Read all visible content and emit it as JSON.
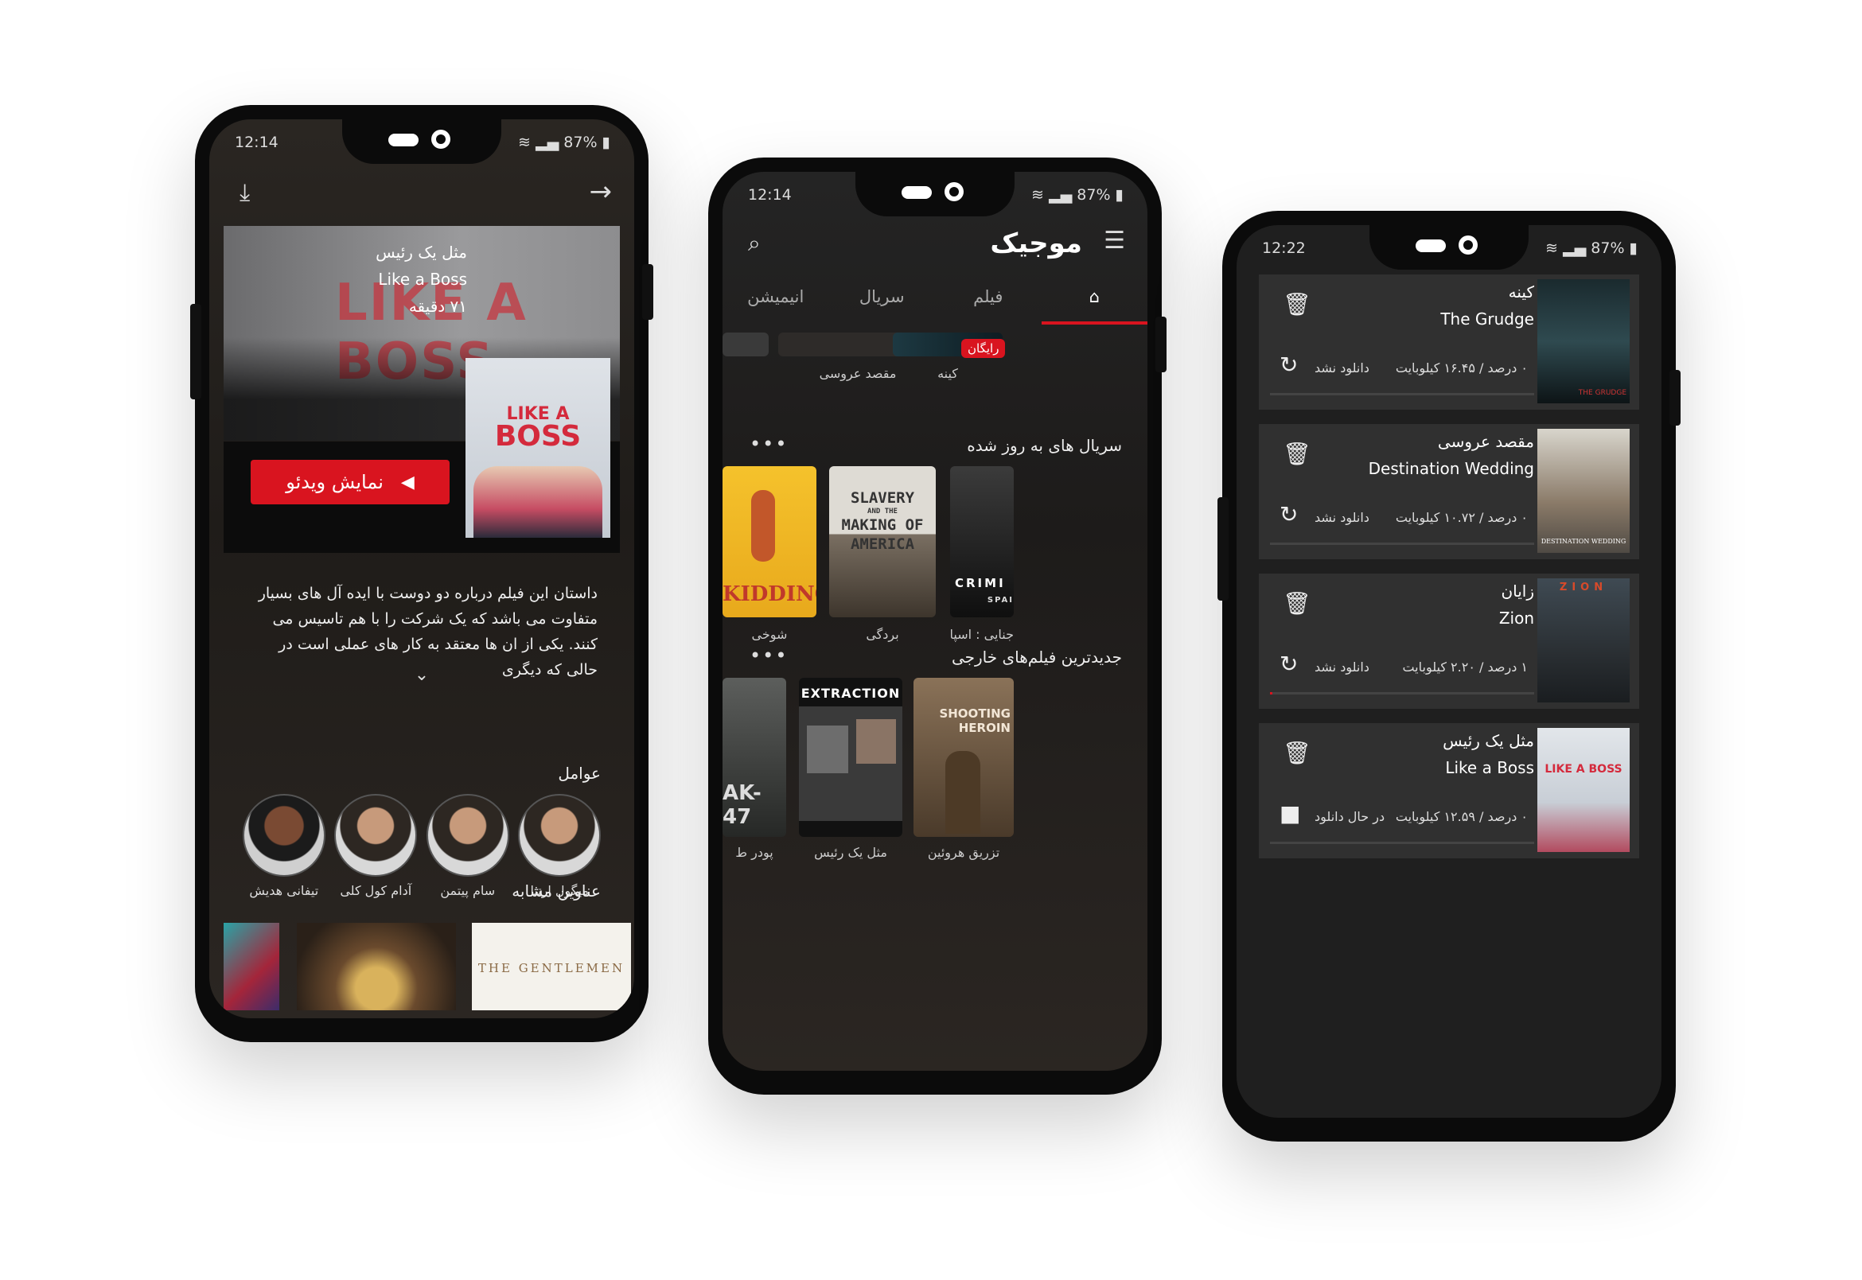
{
  "phone1": {
    "status": {
      "time": "12:14",
      "battery": "87%"
    },
    "hero": {
      "title_fa": "مثل یک رئیس",
      "title_en": "Like a Boss",
      "duration": "۷۱ دقیقه",
      "bg_text": "LIKE A BOSS",
      "poster_line1": "LIKE A",
      "poster_line2": "BOSS"
    },
    "play_label": "نمایش ویدئو",
    "synopsis": "داستان این فیلم درباره دو دوست با ایده آل های بسیار متفاوت می باشد که یک شرکت را با هم تاسیس می کنند. یکی از ان ها معتقد به کار های عملی است در حالی که دیگری",
    "cast_title": "عوامل",
    "cast": [
      "میگول ارتتا",
      "سام پیتمن",
      "آدام کول کلی",
      "تیفانی هدیش"
    ],
    "similar_title": "عناوین مشابه",
    "similar": [
      "THE GENTLEMEN"
    ]
  },
  "phone2": {
    "status": {
      "time": "12:14",
      "battery": "87%"
    },
    "logo": "موجیک",
    "tabs": [
      "خانه",
      "فیلم",
      "سریال",
      "انیمیشن"
    ],
    "top_row": [
      {
        "caption": "کینه",
        "badge": "رایگان"
      },
      {
        "caption": "مقصد عروسی"
      }
    ],
    "series_title": "سریال های به روز شده",
    "series": [
      {
        "caption": "شوخی",
        "poster": "KIDDING"
      },
      {
        "caption": "بردگی",
        "poster_lines": [
          "SLAVERY",
          "AND THE",
          "MAKING OF",
          "AMERICA"
        ]
      },
      {
        "caption": "جنایی : اسپانیا",
        "poster_lines": [
          "CRIMI",
          "SPAI"
        ]
      }
    ],
    "foreign_title": "جدیدترین فیلم‌های خارجی",
    "foreign": [
      {
        "caption": "پودر ط",
        "poster": "AK-47"
      },
      {
        "caption": "مثل یک رئیس",
        "poster": "EXTRACTION"
      },
      {
        "caption": "تزریق هروئین",
        "poster_lines": [
          "SHOOTING",
          "HEROIN"
        ]
      }
    ],
    "more_label": "•••"
  },
  "phone3": {
    "status": {
      "time": "12:22",
      "battery": "87%"
    },
    "downloads": [
      {
        "fa": "کینه",
        "en": "The Grudge",
        "size": "۰ درصد / ۱۶.۴۵ کیلوبایت",
        "status": "دانلود نشد",
        "progress": 0,
        "cover": "THE GRUDGE"
      },
      {
        "fa": "مقصد عروسی",
        "en": "Destination Wedding",
        "size": "۰ درصد / ۱۰.۷۲ کیلوبایت",
        "status": "دانلود نشد",
        "progress": 0,
        "cover": "DESTINATION WEDDING"
      },
      {
        "fa": "زایان",
        "en": "Zion",
        "size": "۱ درصد / ۲.۲۰ کیلوبایت",
        "status": "دانلود نشد",
        "progress": 0.01,
        "cover": "ZION"
      },
      {
        "fa": "مثل یک رئیس",
        "en": "Like a Boss",
        "size": "۰ درصد / ۱۲.۵۹ کیلوبایت",
        "status": "در حال دانلود",
        "progress": 0,
        "cover": "LIKE A BOSS"
      }
    ]
  },
  "colors": {
    "accent": "#d9141f",
    "background": "#1f1f1f",
    "card": "#303030"
  }
}
